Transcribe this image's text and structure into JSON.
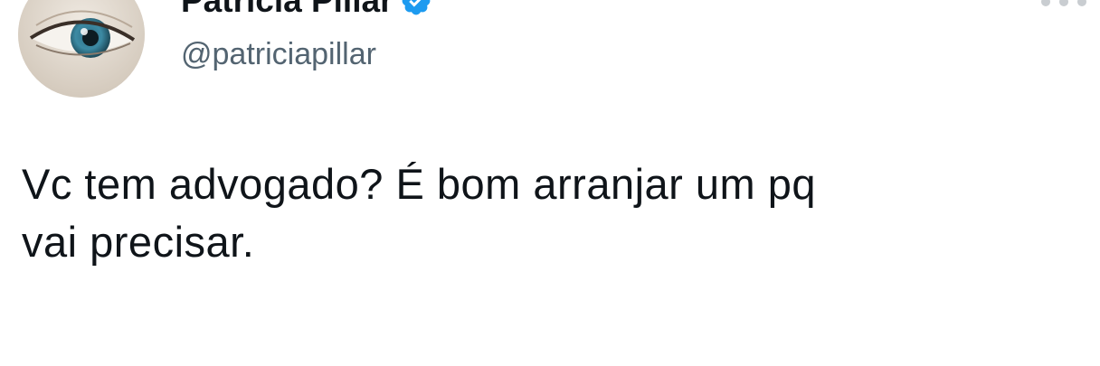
{
  "author": {
    "display_name": "Patricia Pillar",
    "handle": "@patriciapillar",
    "verified": true,
    "avatar_icon": "eye-closeup-photo"
  },
  "tweet": {
    "text": "Vc tem advogado? É bom arranjar um pq\nvai precisar."
  },
  "colors": {
    "text_primary": "#0f1419",
    "text_secondary": "#536471",
    "verified_blue": "#1d9bf0",
    "background": "#ffffff"
  }
}
